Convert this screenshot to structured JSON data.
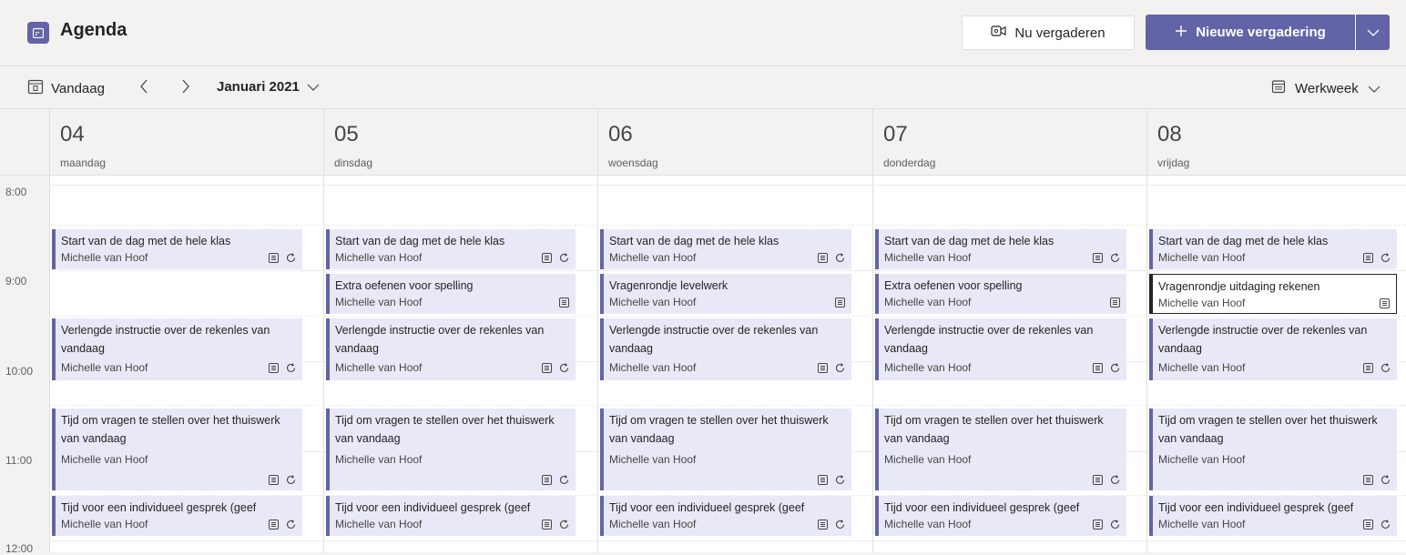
{
  "app": {
    "title": "Agenda",
    "icon": "calendar-icon"
  },
  "header": {
    "meet_now_label": "Nu vergaderen",
    "new_meeting_label": "Nieuwe vergadering"
  },
  "toolbar": {
    "today_label": "Vandaag",
    "month_label": "Januari 2021",
    "view_label": "Werkweek"
  },
  "days": [
    {
      "num": "04",
      "name": "maandag"
    },
    {
      "num": "05",
      "name": "dinsdag"
    },
    {
      "num": "06",
      "name": "woensdag"
    },
    {
      "num": "07",
      "name": "donderdag"
    },
    {
      "num": "08",
      "name": "vrijdag"
    }
  ],
  "times": [
    "8:00",
    "9:00",
    "10:00",
    "11:00",
    "12:00"
  ],
  "events": {
    "start_title": "Start van de dag met de hele klas",
    "extra_spelling": "Extra oefenen voor spelling",
    "levelwerk": "Vragenrondje levelwerk",
    "uitdaging": "Vragenrondje uitdaging rekenen",
    "instructie": "Verlengde instructie over de rekenles van vandaag",
    "vragen": "Tijd om vragen te stellen over het thuiswerk van vandaag",
    "gesprek": "Tijd voor een individueel gesprek (geef",
    "organizer": "Michelle van Hoof"
  },
  "colors": {
    "accent": "#6264a7",
    "event_bg": "#e8e8f7"
  }
}
